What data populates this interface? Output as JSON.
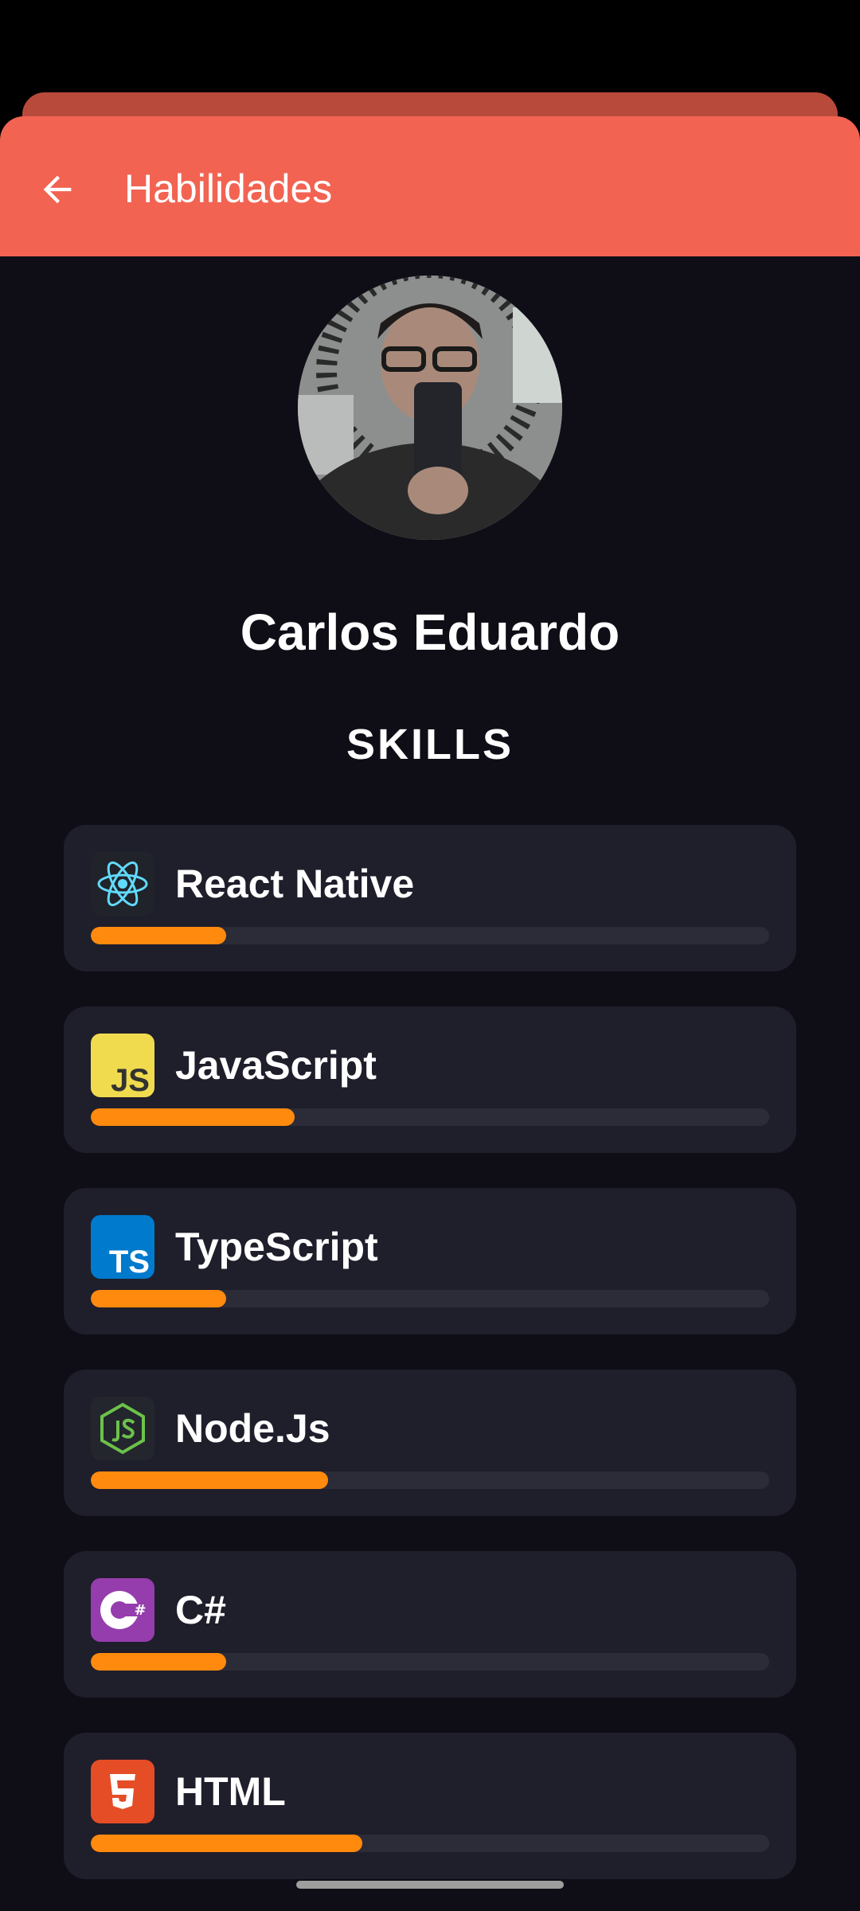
{
  "appbar": {
    "title": "Habilidades",
    "back_icon": "arrow-left-icon"
  },
  "profile": {
    "name": "Carlos Eduardo",
    "avatar": "profile-photo"
  },
  "skills_title": "SKILLS",
  "colors": {
    "appbar": "#f26352",
    "progress": "#ff8a0e",
    "card": "#1f1e2b",
    "background": "#0f0e17"
  },
  "skills": [
    {
      "name": "React Native",
      "icon": "react-icon",
      "level": 0.2
    },
    {
      "name": "JavaScript",
      "icon": "javascript-icon",
      "level": 0.3
    },
    {
      "name": "TypeScript",
      "icon": "typescript-icon",
      "level": 0.2
    },
    {
      "name": "Node.Js",
      "icon": "nodejs-icon",
      "level": 0.35
    },
    {
      "name": "C#",
      "icon": "csharp-icon",
      "level": 0.2
    },
    {
      "name": "HTML",
      "icon": "html5-icon",
      "level": 0.4
    }
  ]
}
